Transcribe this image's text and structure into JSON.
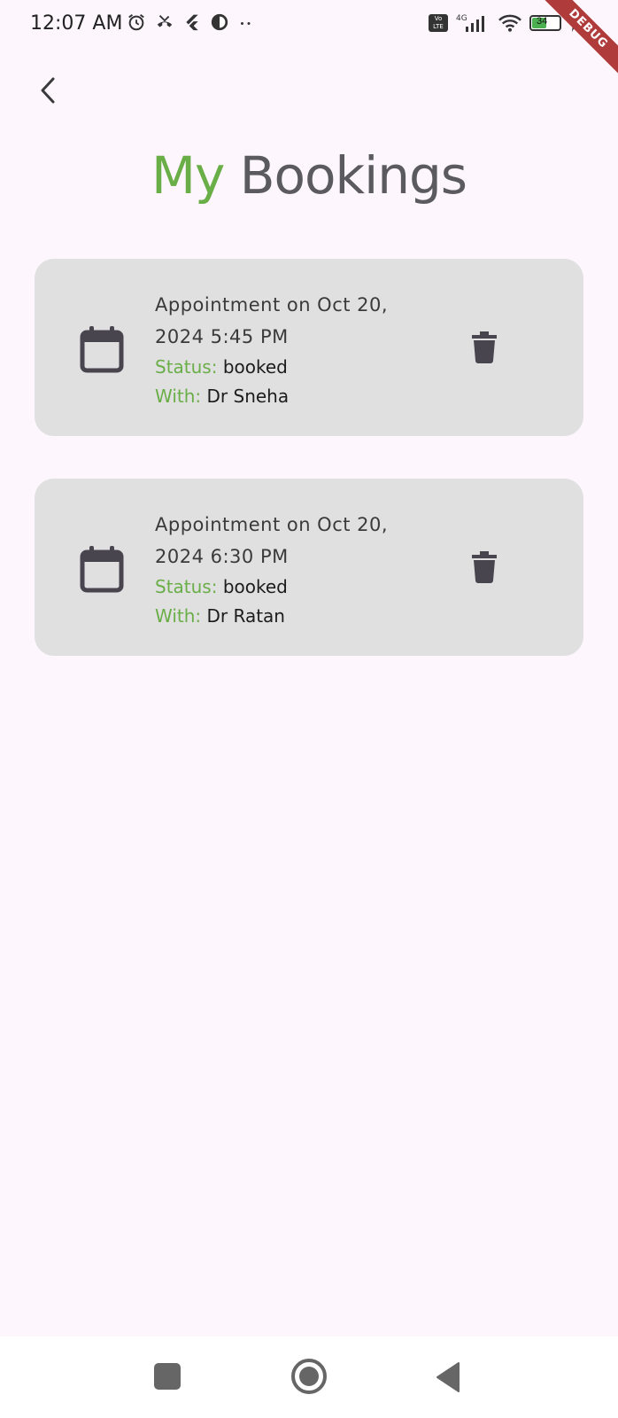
{
  "status_bar": {
    "time": "12:07 AM",
    "battery_level": "34",
    "network": "4G",
    "volte": "Vo LTE"
  },
  "debug_banner": "DEBUG",
  "header": {
    "title_part1": "My",
    "title_part2": "Bookings"
  },
  "bookings": [
    {
      "appointment_line1": "Appointment on Oct 20,",
      "appointment_line2": "2024 5:45 PM",
      "status_label": "Status:",
      "status_value": "booked",
      "with_label": "With:",
      "with_value": "Dr Sneha"
    },
    {
      "appointment_line1": "Appointment on Oct 20,",
      "appointment_line2": "2024 6:30 PM",
      "status_label": "Status:",
      "status_value": "booked",
      "with_label": "With:",
      "with_value": "Dr Ratan"
    }
  ],
  "colors": {
    "accent_green": "#6aae48",
    "title_gray": "#5b5a5e",
    "card_bg": "#e0e0e0",
    "page_bg": "#fdf6fd",
    "icon_dark": "#49454f"
  },
  "icons": {
    "back": "chevron-left-icon",
    "calendar": "calendar-icon",
    "delete": "trash-icon",
    "nav_recents": "square-icon",
    "nav_home": "circle-icon",
    "nav_back": "triangle-back-icon"
  }
}
